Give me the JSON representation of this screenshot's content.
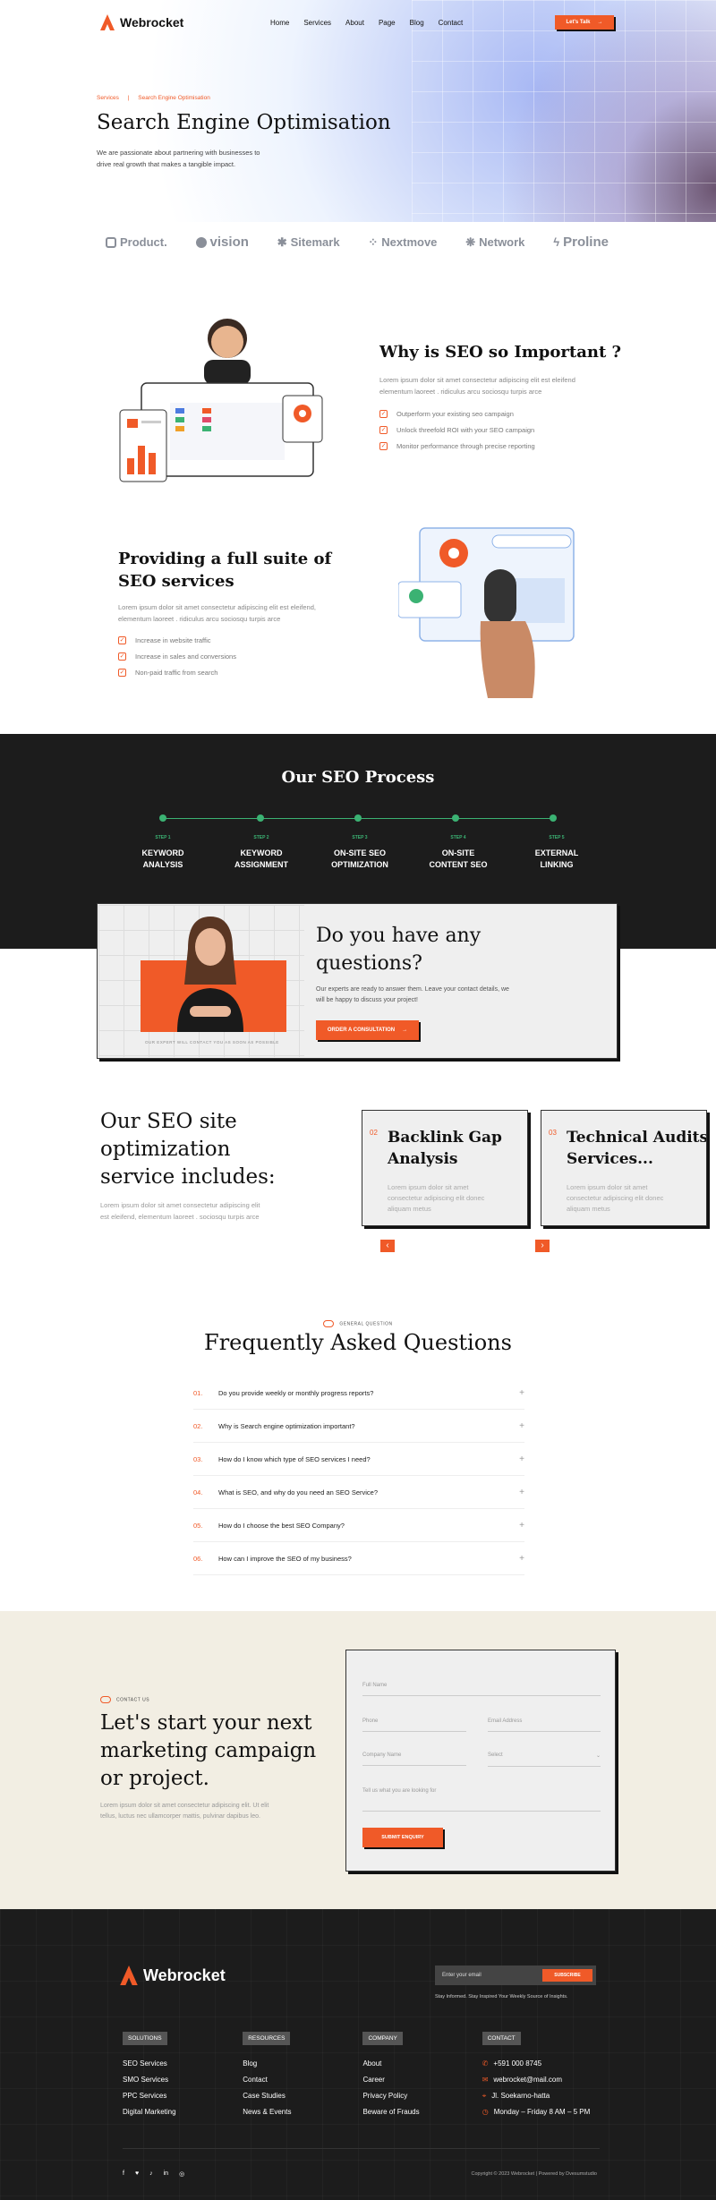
{
  "header": {
    "logo_text": "Webrocket",
    "nav": [
      "Home",
      "Services",
      "About",
      "Page",
      "Blog",
      "Contact"
    ],
    "cta": "Let's Talk",
    "cta_arrow": "→"
  },
  "hero": {
    "breadcrumb_home": "Services",
    "breadcrumb_sep": "|",
    "breadcrumb_current": "Search Engine Optimisation",
    "title": "Search Engine Optimisation",
    "subtitle_1": "We are passionate about partnering with businesses to",
    "subtitle_2": "drive real growth that makes a tangible impact."
  },
  "brands": [
    "Product.",
    "vision",
    "Sitemark",
    "Nextmove",
    "Network",
    "Proline"
  ],
  "why": {
    "title": "Why is SEO so Important ?",
    "text_1": "Lorem ipsum dolor sit amet consectetur adipiscing elit est eleifend",
    "text_2": "elementum laoreet . ridiculus arcu sociosqu turpis arce",
    "items": [
      "Outperform your existing seo campaign",
      "Unlock threefold ROI with your SEO campaign",
      "Monitor performance through precise reporting"
    ]
  },
  "suite": {
    "title_1": "Providing a full suite of",
    "title_2": "SEO services",
    "text_1": "Lorem ipsum dolor sit amet consectetur adipiscing elit est eleifend,",
    "text_2": "elementum laoreet . ridiculus arcu sociosqu turpis arce",
    "items": [
      "Increase in website traffic",
      "Increase in sales and conversions",
      "Non-paid traffic from search"
    ]
  },
  "process": {
    "title": "Our SEO Process",
    "steps": [
      {
        "label": "STEP 1",
        "line1": "KEYWORD",
        "line2": "ANALYSIS"
      },
      {
        "label": "STEP 2",
        "line1": "KEYWORD",
        "line2": "ASSIGNMENT"
      },
      {
        "label": "STEP 3",
        "line1": "ON-SITE SEO",
        "line2": "OPTIMIZATION"
      },
      {
        "label": "STEP 4",
        "line1": "ON-SITE",
        "line2": "CONTENT SEO"
      },
      {
        "label": "STEP 5",
        "line1": "EXTERNAL",
        "line2": "LINKING"
      }
    ]
  },
  "questions": {
    "title_1": "Do you have any",
    "title_2": "questions?",
    "text_1": "Our experts are ready to answer them. Leave your contact details, we",
    "text_2": "will be happy to discuss your project!",
    "button": "ORDER A CONSULTATION",
    "caption": "OUR EXPERT WILL CONTACT YOU AS SOON AS POSSIBLE"
  },
  "includes": {
    "title_1": "Our SEO site",
    "title_2": "optimization",
    "title_3": "service includes:",
    "text_1": "Lorem ipsum dolor sit amet consectetur adipiscing elit",
    "text_2": "est eleifend, elementum laoreet . sociosqu turpis arce",
    "cards": [
      {
        "num": "02",
        "title_1": "Backlink Gap",
        "title_2": "Analysis",
        "text_1": "Lorem ipsum dolor sit amet",
        "text_2": "consectetur adipiscing elit donec",
        "text_3": "aliquam metus"
      },
      {
        "num": "03",
        "title_1": "Technical Audits",
        "title_2": "Services...",
        "text_1": "Lorem ipsum dolor sit amet",
        "text_2": "consectetur adipiscing elit donec",
        "text_3": "aliquam metus"
      }
    ],
    "prev": "‹",
    "next": "›"
  },
  "faq": {
    "tag": "GENERAL QUESTION",
    "title": "Frequently Asked Questions",
    "items": [
      {
        "n": "01.",
        "q": "Do you provide weekly or monthly progress reports?"
      },
      {
        "n": "02.",
        "q": "Why is Search engine optimization important?"
      },
      {
        "n": "03.",
        "q": "How do I know which type of SEO services I need?"
      },
      {
        "n": "04.",
        "q": "What is SEO, and why do you need an SEO Service?"
      },
      {
        "n": "05.",
        "q": "How do I choose the best SEO Company?"
      },
      {
        "n": "06.",
        "q": "How can I improve the SEO of my business?"
      }
    ],
    "plus": "+"
  },
  "contact": {
    "tag": "CONTACT US",
    "title_1": "Let's start your next",
    "title_2": "marketing campaign",
    "title_3": "or project.",
    "text_1": "Lorem ipsum dolor sit amet consectetur adipiscing elit. Ut elit",
    "text_2": "tellus, luctus nec ullamcorper mattis, pulvinar dapibus leo.",
    "form": {
      "full_name": "Full Name",
      "phone": "Phone",
      "email": "Email Address",
      "company": "Company Name",
      "select": "Select",
      "message": "Tell us what you are looking for",
      "submit": "SUBMIT ENQUIRY"
    }
  },
  "footer": {
    "logo_text": "Webrocket",
    "email_placeholder": "Enter your email",
    "subscribe": "SUBSCRIBE",
    "newsletter_note": "Stay Informed. Stay Inspired Your Weekly Source of Insights.",
    "columns": [
      {
        "head": "SOLUTIONS",
        "items": [
          "SEO Services",
          "SMO Services",
          "PPC Services",
          "Digital Marketing"
        ]
      },
      {
        "head": "RESOURCES",
        "items": [
          "Blog",
          "Contact",
          "Case Studies",
          "News & Events"
        ]
      },
      {
        "head": "COMPANY",
        "items": [
          "About",
          "Career",
          "Privacy Policy",
          "Beware of Frauds"
        ]
      }
    ],
    "contact_head": "CONTACT",
    "contact_items": [
      "+591 000 8745",
      "webrocket@mail.com",
      "Jl. Soekarno-hatta",
      "Monday – Friday 8 AM – 5 PM"
    ],
    "copyright": "Copyright © 2023 Webrocket | Powered by Dvesumstudio"
  },
  "colors": {
    "accent": "#f05a28",
    "dark": "#1c1c1c",
    "green": "#3bb273",
    "cream": "#f2eee3"
  }
}
